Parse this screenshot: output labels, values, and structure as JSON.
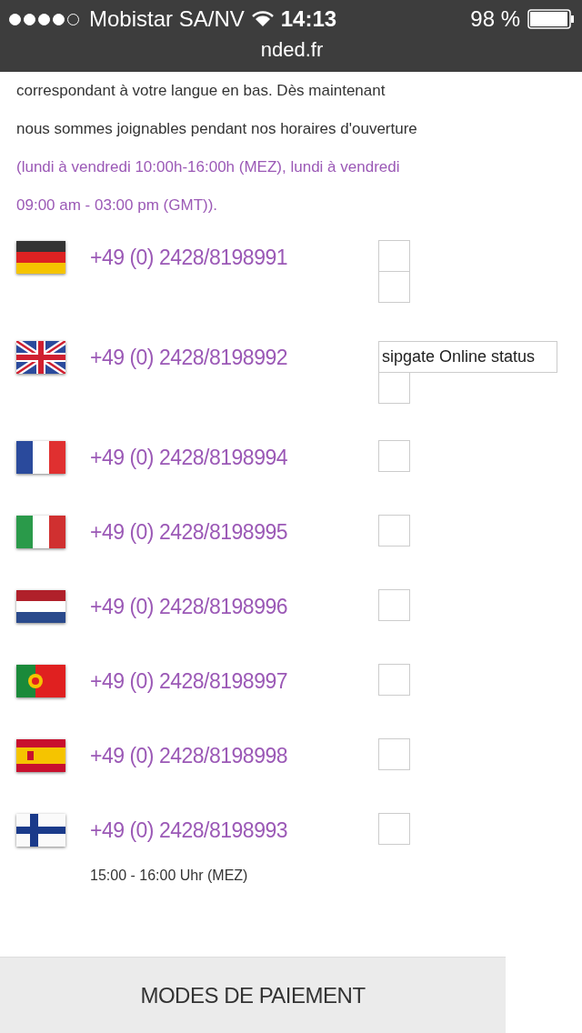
{
  "status_bar": {
    "carrier": "Mobistar SA/NV",
    "time": "14:13",
    "battery": "98 %"
  },
  "address_bar": {
    "url": "nded.fr"
  },
  "intro": [
    {
      "text": "correspondant à votre langue en bas. Dès maintenant",
      "kind": "plain"
    },
    {
      "text": "nous sommes joignables pendant nos horaires d'ouverture",
      "kind": "plain"
    },
    {
      "text": "(lundi à vendredi 10:00h-16:00h (MEZ), lundi à vendredi",
      "kind": "accent"
    },
    {
      "text": "09:00 am - 03:00 pm (GMT)).",
      "kind": "accent"
    }
  ],
  "phones": [
    {
      "kind": "de",
      "number": "+49 (0) 2428/8198991",
      "status": [
        {
          "kind": "empty"
        },
        {
          "kind": "empty"
        }
      ]
    },
    {
      "kind": "gb",
      "number": "+49 (0) 2428/8198992",
      "status": [
        {
          "kind": "label",
          "text": "sipgate Online status"
        },
        {
          "kind": "empty"
        }
      ]
    },
    {
      "kind": "fr",
      "number": "+49 (0) 2428/8198994",
      "status": [
        {
          "kind": "empty"
        }
      ]
    },
    {
      "kind": "it",
      "number": "+49 (0) 2428/8198995",
      "status": [
        {
          "kind": "empty"
        }
      ]
    },
    {
      "kind": "nl",
      "number": "+49 (0) 2428/8198996",
      "status": [
        {
          "kind": "empty"
        }
      ]
    },
    {
      "kind": "pt",
      "number": "+49 (0) 2428/8198997",
      "status": [
        {
          "kind": "empty"
        }
      ]
    },
    {
      "kind": "es",
      "number": "+49 (0) 2428/8198998",
      "status": [
        {
          "kind": "empty"
        }
      ]
    },
    {
      "kind": "fi",
      "number": "+49 (0) 2428/8198993",
      "status": [
        {
          "kind": "empty"
        }
      ],
      "hours": "15:00 - 16:00 Uhr (MEZ)"
    }
  ],
  "footer_button": {
    "label": "MODES DE PAIEMENT"
  }
}
